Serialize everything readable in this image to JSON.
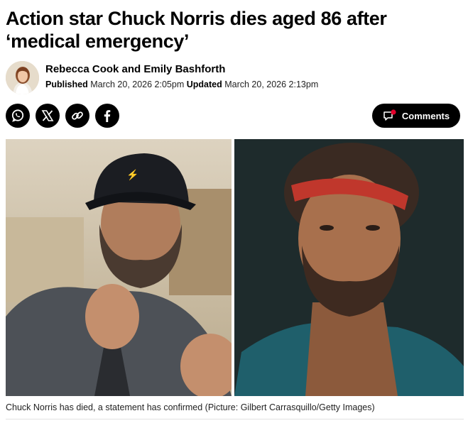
{
  "article": {
    "headline": "Action star Chuck Norris dies aged 86 after ‘medical emergency’",
    "authors": "Rebecca Cook and Emily Bashforth",
    "published_label": "Published",
    "published_date": "March 20, 2026 2:05pm",
    "updated_label": "Updated",
    "updated_date": "March 20, 2026 2:13pm",
    "caption": "Chuck Norris has died, a statement has confirmed (Picture: Gilbert Carrasquillo/Getty Images)"
  },
  "share": {
    "buttons": [
      {
        "icon": "whatsapp-icon"
      },
      {
        "icon": "x-icon"
      },
      {
        "icon": "link-icon"
      },
      {
        "icon": "facebook-icon"
      }
    ],
    "comments_label": "Comments",
    "comments_icon": "comment-bubble-icon",
    "notification_color": "#e4002b"
  },
  "colors": {
    "button_bg": "#000000",
    "text": "#000000"
  }
}
